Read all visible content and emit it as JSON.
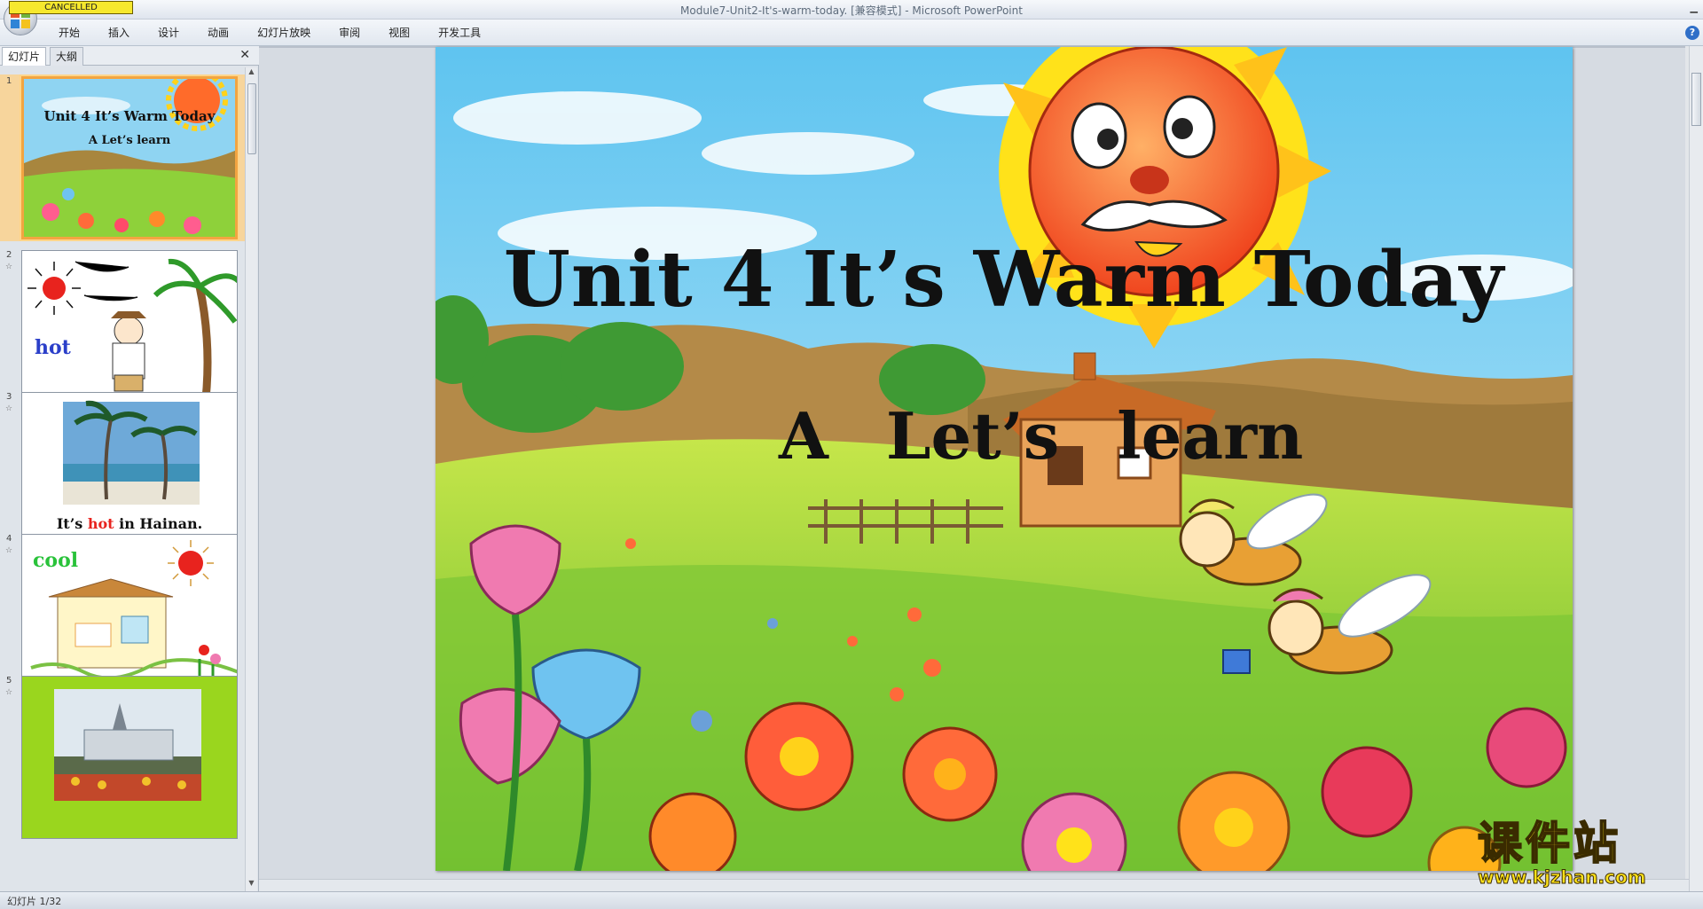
{
  "titlebar": {
    "window_title": "Module7-Unit2-It's-warm-today. [兼容模式] - Microsoft PowerPoint",
    "badge": "CANCELLED"
  },
  "ribbon": {
    "tabs": [
      "开始",
      "插入",
      "设计",
      "动画",
      "幻灯片放映",
      "审阅",
      "视图",
      "开发工具"
    ],
    "help": "?"
  },
  "panel": {
    "tab_slides": "幻灯片",
    "tab_outline": "大纲",
    "close": "✕"
  },
  "thumbnails": [
    {
      "num": "1",
      "title": "Unit 4 It’s Warm Today",
      "subtitle": "A  Let’s learn"
    },
    {
      "num": "2",
      "word": "hot"
    },
    {
      "num": "3",
      "caption_pre": "It’s ",
      "caption_hot": "hot",
      "caption_post": " in Hainan."
    },
    {
      "num": "4",
      "word": "cool"
    },
    {
      "num": "5"
    }
  ],
  "slide": {
    "title": "Unit 4 It’s Warm Today",
    "subtitle": "A   Let’s learn"
  },
  "watermark": {
    "text": "课件站",
    "url": "www.kjzhan.com"
  },
  "status": {
    "slide_counter": "幻灯片 1/32"
  },
  "colors": {
    "accent_orange": "#f2a541",
    "hot_red": "#e8231e",
    "hot_blue": "#2b3fc9",
    "cool_green": "#29c23a"
  }
}
